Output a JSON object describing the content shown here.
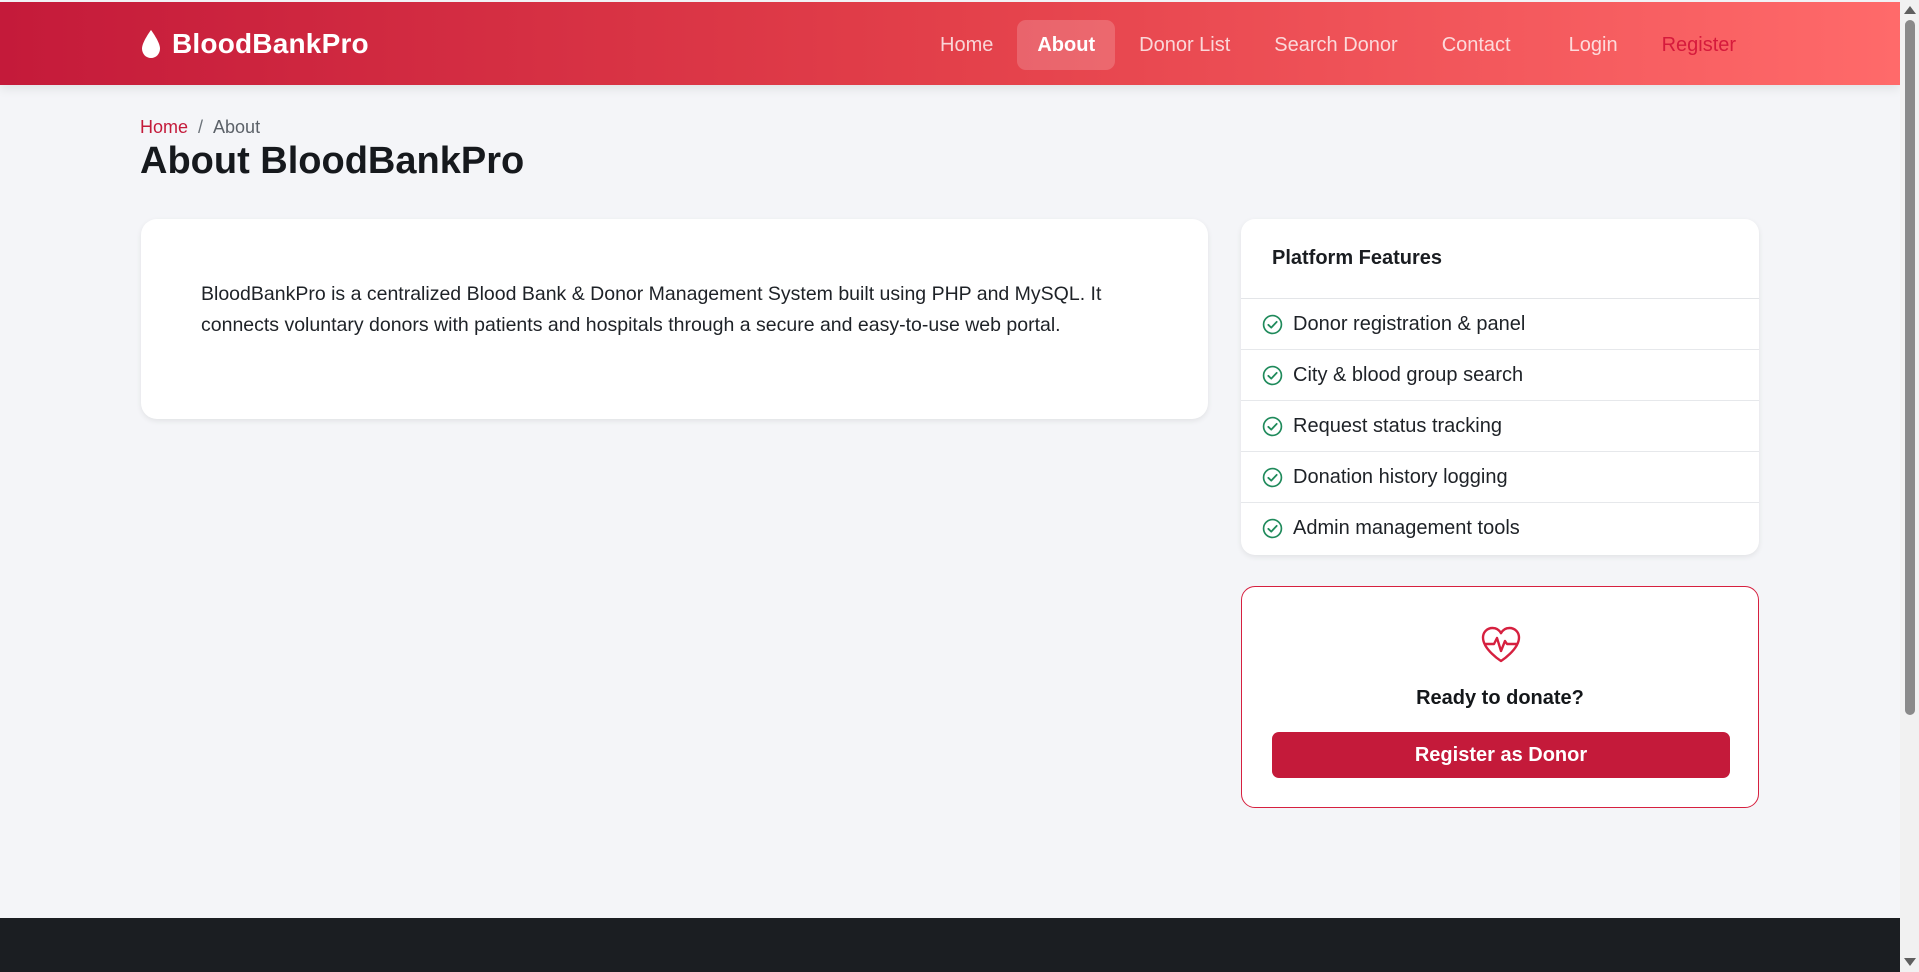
{
  "brand": {
    "name": "BloodBankPro",
    "icon": "blood-drop-icon"
  },
  "nav": {
    "items": [
      {
        "label": "Home"
      },
      {
        "label": "About",
        "active": true
      },
      {
        "label": "Donor List"
      },
      {
        "label": "Search Donor"
      },
      {
        "label": "Contact"
      },
      {
        "label": "Login"
      },
      {
        "label": "Register"
      }
    ]
  },
  "breadcrumb": {
    "home": "Home",
    "separator": "/",
    "current": "About"
  },
  "page_title": "About BloodBankPro",
  "about": {
    "text": "BloodBankPro is a centralized Blood Bank & Donor Management System built using PHP and MySQL. It connects voluntary donors with patients and hospitals through a secure and easy-to-use web portal."
  },
  "features": {
    "title": "Platform Features",
    "icon": "check-circle-icon",
    "items": [
      "Donor registration & panel",
      "City & blood group search",
      "Request status tracking",
      "Donation history logging",
      "Admin management tools"
    ]
  },
  "donate": {
    "icon": "heart-pulse-icon",
    "title": "Ready to donate?",
    "button_label": "Register as Donor"
  },
  "colors": {
    "primary": "#c41a3a",
    "gradient_start": "#c41a3a",
    "gradient_end": "#ff6a6a",
    "success": "#1f8a5b",
    "footer": "#1b1e22",
    "background": "#f4f5f8"
  }
}
